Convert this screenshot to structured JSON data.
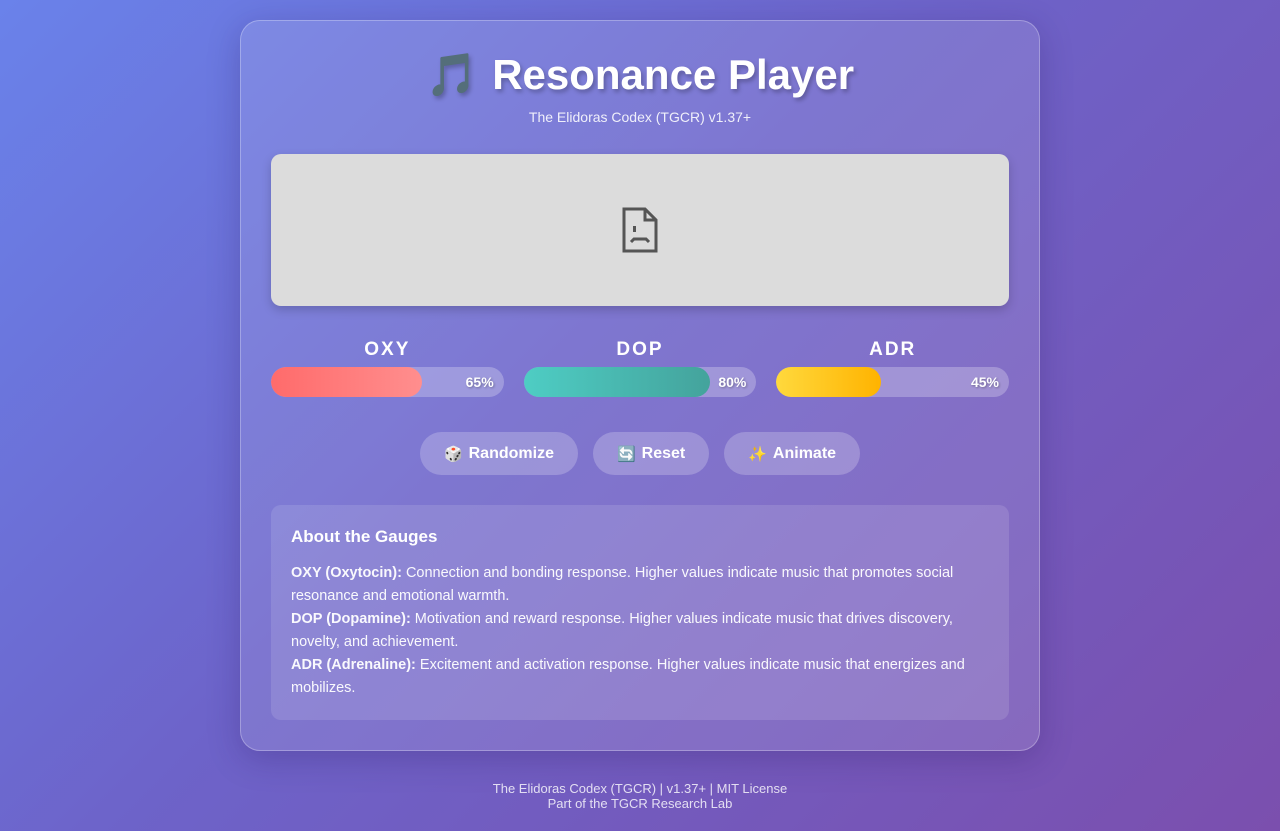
{
  "header": {
    "icon": "musical-notes-icon",
    "title": "Resonance Player",
    "subtitle": "The Elidoras Codex (TGCR) v1.37+"
  },
  "visualization": {
    "icon": "broken-file-icon"
  },
  "gauges": [
    {
      "label": "OXY",
      "value_text": "65%",
      "value": 65,
      "color": "#ff6b6b"
    },
    {
      "label": "DOP",
      "value_text": "80%",
      "value": 80,
      "color": "#4ecdc4"
    },
    {
      "label": "ADR",
      "value_text": "45%",
      "value": 45,
      "color": "#ffd93d"
    }
  ],
  "buttons": {
    "randomize": {
      "icon": "🎲",
      "label": "Randomize"
    },
    "reset": {
      "icon": "🔄",
      "label": "Reset"
    },
    "animate": {
      "icon": "✨",
      "label": "Animate"
    }
  },
  "about": {
    "title": "About the Gauges",
    "items": [
      {
        "term": "OXY (Oxytocin):",
        "desc": " Connection and bonding response. Higher values indicate music that promotes social resonance and emotional warmth."
      },
      {
        "term": "DOP (Dopamine):",
        "desc": " Motivation and reward response. Higher values indicate music that drives discovery, novelty, and achievement."
      },
      {
        "term": "ADR (Adrenaline):",
        "desc": " Excitement and activation response. Higher values indicate music that energizes and mobilizes."
      }
    ]
  },
  "footer": {
    "line1": "The Elidoras Codex (TGCR) | v1.37+ | MIT License",
    "line2": "Part of the TGCR Research Lab"
  }
}
